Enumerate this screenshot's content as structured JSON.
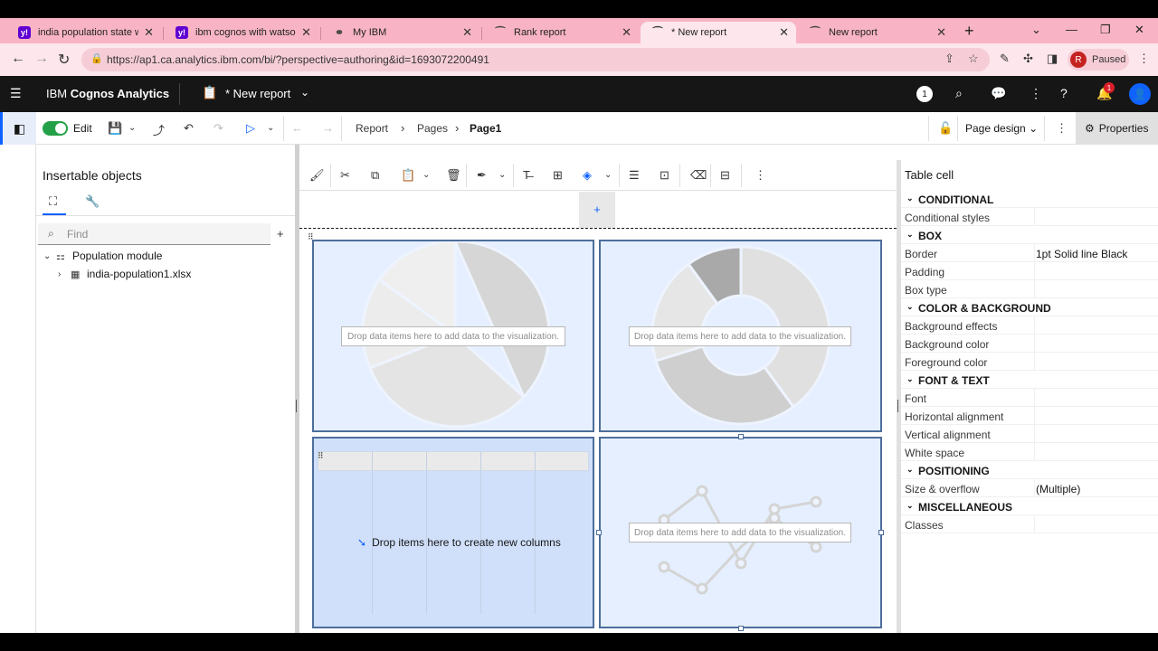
{
  "browser": {
    "tabs": [
      {
        "title": "india population state wise",
        "favicon": "yahoo-icon"
      },
      {
        "title": "ibm cognos with watson - Y",
        "favicon": "yahoo-icon"
      },
      {
        "title": "My IBM",
        "favicon": "ibm-icon"
      },
      {
        "title": "Rank report",
        "favicon": "cognos-icon"
      },
      {
        "title": "* New report",
        "favicon": "cognos-icon",
        "active": true
      },
      {
        "title": "New report",
        "favicon": "cognos-icon"
      }
    ],
    "url": "https://ap1.ca.analytics.ibm.com/bi/?perspective=authoring&id=1693072200491",
    "profile_initial": "R",
    "profile_label": "Paused"
  },
  "app": {
    "brand_prefix": "IBM",
    "brand_name": "Cognos Analytics",
    "report_name": "* New report",
    "notifications_count": "1",
    "alerts_badge": "1",
    "accent": "#0f62fe"
  },
  "toolbar": {
    "edit_label": "Edit",
    "breadcrumb": [
      "Report",
      "Pages",
      "Page1"
    ],
    "page_design_label": "Page design",
    "properties_label": "Properties"
  },
  "left_panel": {
    "title": "Insertable objects",
    "find_placeholder": "Find",
    "tree": [
      {
        "label": "Population module",
        "icon": "module-icon",
        "expanded": true
      },
      {
        "label": "india-population1.xlsx",
        "icon": "table-icon",
        "expanded": false
      }
    ]
  },
  "canvas": {
    "drop_data_text": "Drop data items here to add data to the visualization.",
    "drop_columns_text": "Drop items here to create new columns"
  },
  "properties": {
    "title": "Table cell",
    "rows": [
      {
        "type": "section",
        "label": "CONDITIONAL"
      },
      {
        "type": "prop",
        "label": "Conditional styles",
        "value": ""
      },
      {
        "type": "section",
        "label": "BOX"
      },
      {
        "type": "prop",
        "label": "Border",
        "value": "1pt Solid line Black"
      },
      {
        "type": "prop",
        "label": "Padding",
        "value": ""
      },
      {
        "type": "prop",
        "label": "Box type",
        "value": ""
      },
      {
        "type": "section",
        "label": "COLOR & BACKGROUND"
      },
      {
        "type": "prop",
        "label": "Background effects",
        "value": ""
      },
      {
        "type": "prop",
        "label": "Background color",
        "value": ""
      },
      {
        "type": "prop",
        "label": "Foreground color",
        "value": ""
      },
      {
        "type": "section",
        "label": "FONT & TEXT"
      },
      {
        "type": "prop",
        "label": "Font",
        "value": ""
      },
      {
        "type": "prop",
        "label": "Horizontal alignment",
        "value": ""
      },
      {
        "type": "prop",
        "label": "Vertical alignment",
        "value": ""
      },
      {
        "type": "prop",
        "label": "White space",
        "value": ""
      },
      {
        "type": "section",
        "label": "POSITIONING"
      },
      {
        "type": "prop",
        "label": "Size & overflow",
        "value": "(Multiple)"
      },
      {
        "type": "section",
        "label": "MISCELLANEOUS"
      },
      {
        "type": "prop",
        "label": "Classes",
        "value": ""
      }
    ]
  }
}
